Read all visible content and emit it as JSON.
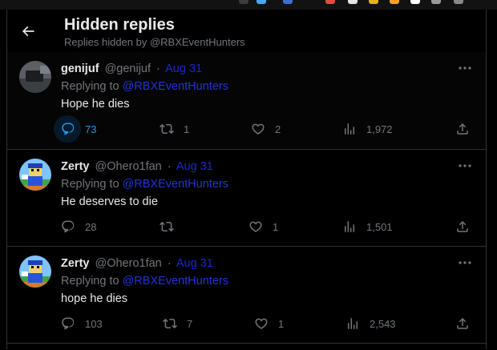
{
  "colors": {
    "accent": "#1d9bf0",
    "muted": "#71767b",
    "text": "#e7e9ea",
    "divider": "#2f3336",
    "link": "#2234d6"
  },
  "header": {
    "title": "Hidden replies",
    "subtitle": "Replies hidden by @RBXEventHunters",
    "back_icon": "arrow-left-icon"
  },
  "tweets": [
    {
      "name": "genijuf",
      "handle": "@genijuf",
      "separator": "·",
      "date": "Aug 31",
      "replying_prefix": "Replying to",
      "replying_to": "@RBXEventHunters",
      "text": "Hope he dies",
      "replies": "73",
      "retweets": "1",
      "likes": "2",
      "views": "1,972",
      "avatar_icon": "dark-photo-avatar"
    },
    {
      "name": "Zerty",
      "handle": "@Ohero1fan",
      "separator": "·",
      "date": "Aug 31",
      "replying_prefix": "Replying to",
      "replying_to": "@RBXEventHunters",
      "text": "He deserves to die",
      "replies": "28",
      "retweets": "",
      "likes": "1",
      "views": "1,501",
      "avatar_icon": "roblox-character-avatar"
    },
    {
      "name": "Zerty",
      "handle": "@Ohero1fan",
      "separator": "·",
      "date": "Aug 31",
      "replying_prefix": "Replying to",
      "replying_to": "@RBXEventHunters",
      "text": "hope he dies",
      "replies": "103",
      "retweets": "7",
      "likes": "1",
      "views": "2,543",
      "avatar_icon": "roblox-character-avatar"
    }
  ],
  "icons": [
    "reply-icon",
    "retweet-icon",
    "like-icon",
    "views-icon",
    "share-icon",
    "more-icon"
  ]
}
